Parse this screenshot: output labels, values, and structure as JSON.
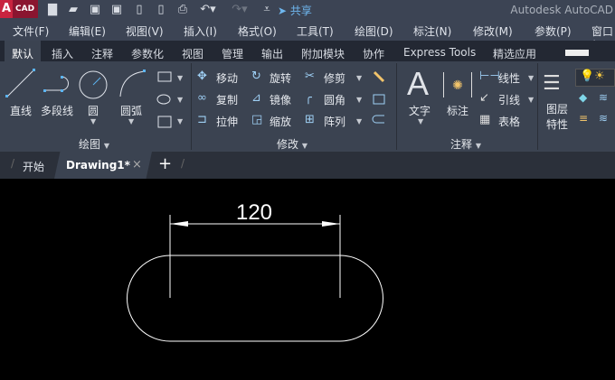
{
  "app": {
    "logo_letter": "A",
    "logo_text": "CAD",
    "title": "Autodesk AutoCAD",
    "share": "共享"
  },
  "menu": [
    "文件(F)",
    "编辑(E)",
    "视图(V)",
    "插入(I)",
    "格式(O)",
    "工具(T)",
    "绘图(D)",
    "标注(N)",
    "修改(M)",
    "参数(P)",
    "窗口("
  ],
  "ribbon_tabs": [
    "默认",
    "插入",
    "注释",
    "参数化",
    "视图",
    "管理",
    "输出",
    "附加模块",
    "协作",
    "Express Tools",
    "精选应用"
  ],
  "draw": {
    "title": "绘图",
    "line": "直线",
    "polyline": "多段线",
    "circle": "圆",
    "arc": "圆弧"
  },
  "modify": {
    "title": "修改",
    "move": "移动",
    "rotate": "旋转",
    "trim": "修剪",
    "copy": "复制",
    "mirror": "镜像",
    "fillet": "圆角",
    "stretch": "拉伸",
    "scale": "缩放",
    "array": "阵列"
  },
  "annotation": {
    "title": "注释",
    "text": "文字",
    "dimension": "标注",
    "linear": "线性",
    "leader": "引线",
    "table": "表格"
  },
  "layers": {
    "properties_line1": "图层",
    "properties_line2": "特性"
  },
  "doc_tabs": {
    "start": "开始",
    "drawing": "Drawing1*",
    "close": "×",
    "new": "+"
  },
  "drawing": {
    "dimension_text": "120",
    "line_color": "#ffffff"
  }
}
